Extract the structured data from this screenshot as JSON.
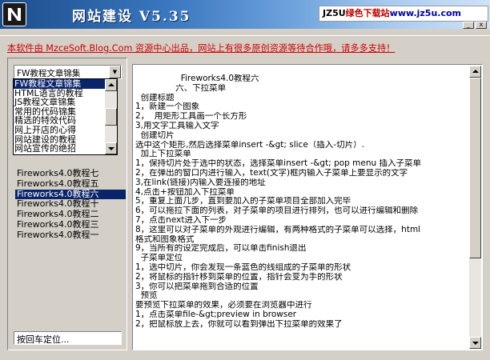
{
  "window": {
    "title": "网站建设 V5.35",
    "brand_part1": "JZ5U",
    "brand_part2": "绿色下载站",
    "brand_part3": "www.jz5u.com",
    "min_label": "_",
    "close_label": "x"
  },
  "banner": {
    "text": "本软件由 MzceSoft.Blog.Com 资源中心出品，网站上有很多原创资源等待合作哦，请多多支持！"
  },
  "category_select": {
    "value": "FW教程文章锦集",
    "options": [
      "FW教程文章锦集",
      "HTML语言的教程",
      "JS教程文章锦集",
      "常用的代码锦集",
      "精选的特效代码",
      "网上开店的心得",
      "网站建设的教程",
      "网站宣传的绝招"
    ]
  },
  "article_list": {
    "items": [
      "Fireworks4.0教程七",
      "Fireworks4.0教程五",
      "Fireworks4.0教程六",
      "Fireworks4.0教程十",
      "Fireworks4.0教程二",
      "Fireworks4.0教程三",
      "Fireworks4.0教程一"
    ],
    "selected_index": 2
  },
  "locate_box": {
    "value": "按回车定位..."
  },
  "content": {
    "lines": [
      "                 Fireworks4.0教程六",
      "               六、下拉菜单",
      "  创建标题",
      "1，新建一个图象",
      "2，  用矩形工具画一个长方形",
      "3,用文字工具输入文字",
      "  创建切片",
      "选中这个矩形,然后选择菜单insert -&gt; slice（插入-切片）.",
      "  加上下拉菜单",
      "1，保持切片处于选中的状态，选择菜单insert -&gt; pop menu 插入子菜单",
      "2，在弹出的窗口内进行输入，text(文字)框内输入子菜单上要显示的文字",
      "3,在link(链接)内输入要连接的地址",
      "4,点击+按钮加入下拉菜单",
      "5，重复上面几步，直到要加入的子菜单项目全部加入完毕",
      "6，可以拖拉下面的列表，对子菜单的项目进行排列，也可以进行编辑和删除",
      "7，点击next进入下一步",
      "8，这里可以对子菜单的外观进行编辑，有两种格式的子菜单可以选择，html",
      "格式和图象格式",
      "9，当所有的设定完成后，可以单击finish退出",
      "  子菜单定位",
      "1，选中切片，你会发现一条蓝色的线组成的子菜单的形状",
      "2，将鼠标的指针移到菜单的位置，指针会变为手的形状",
      "3，你可以把菜单拖到合适的位置",
      "  预览",
      "要预览下拉菜单的效果，必须要在浏览器中进行",
      "1，点击菜单file-&gt;preview in browser",
      "2，把鼠标放上去，你就可以看到弹出下拉菜单的效果了"
    ]
  },
  "colors": {
    "selection": "#0a246a",
    "banner_text": "#d00000",
    "face": "#d4d0c8"
  },
  "icons": {
    "app": "app-n-logo-icon",
    "dropdown_arrow": "chevron-down-icon",
    "scroll_up": "scroll-up-arrow-icon",
    "scroll_down": "scroll-down-arrow-icon"
  }
}
